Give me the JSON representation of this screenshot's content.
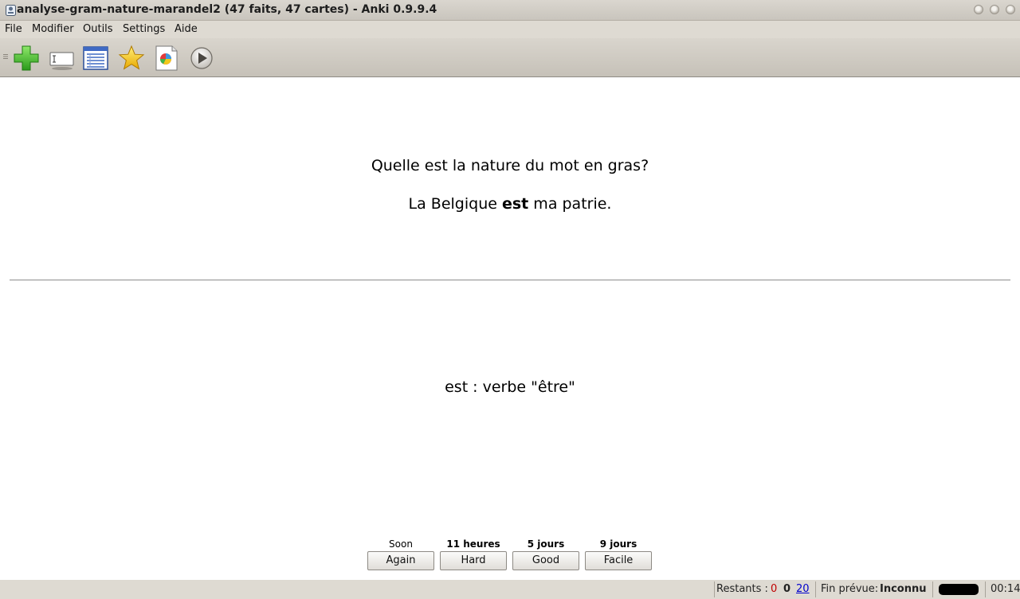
{
  "window": {
    "title": "analyse-gram-nature-marandel2 (47 faits, 47 cartes) - Anki 0.9.9.4"
  },
  "menu": {
    "items": [
      {
        "label": "File"
      },
      {
        "label": "Modifier"
      },
      {
        "label": "Outils"
      },
      {
        "label": "Settings"
      },
      {
        "label": "Aide"
      }
    ]
  },
  "toolbar": {
    "icons": [
      "add-icon",
      "edit-card-icon",
      "browse-icon",
      "star-icon",
      "deck-properties-icon",
      "play-icon"
    ]
  },
  "card": {
    "question": "Quelle est la nature du mot en gras?",
    "sentence_before": "La Belgique ",
    "sentence_bold": "est",
    "sentence_after": " ma patrie.",
    "answer": "est : verbe \"être\""
  },
  "answers": [
    {
      "interval": "Soon",
      "label": "Again"
    },
    {
      "interval": "11 heures",
      "label": "Hard"
    },
    {
      "interval": "5 jours",
      "label": "Good"
    },
    {
      "interval": "9 jours",
      "label": "Facile"
    }
  ],
  "status": {
    "remaining_label": "Restants :",
    "remaining_failed": "0",
    "remaining_review": "0",
    "remaining_new": "20",
    "eta_label": "Fin prévue:",
    "eta_value": "Inconnu",
    "timer": "00:14",
    "colors": {
      "failed": "#c00000",
      "new": "#0000cc"
    }
  }
}
